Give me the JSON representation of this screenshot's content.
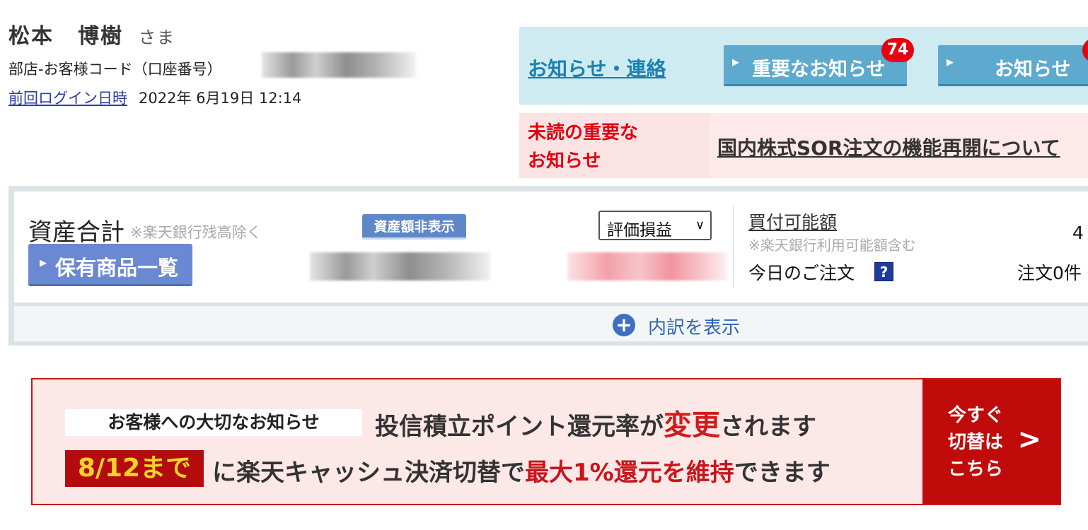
{
  "customer": {
    "family_name": "松本",
    "given_name": "博樹",
    "honorific": "さま",
    "code_label": "部店-お客様コード（口座番号）",
    "last_login_label": "前回ログイン日時",
    "last_login_value": "2022年 6月19日 12:14"
  },
  "notices": {
    "link_label": "お知らせ・連絡",
    "important_button": "重要なお知らせ",
    "important_badge": "74",
    "notices_button": "お知らせ",
    "unread_label_line1": "未読の重要な",
    "unread_label_line2": "お知らせ",
    "unread_link": "国内株式SOR注文の機能再開について"
  },
  "assets": {
    "title": "資産合計",
    "note": "※楽天銀行残高除く",
    "hide_button": "資産額非表示",
    "holdings_button": "保有商品一覧",
    "pl_select": "評価損益",
    "buying_power_label": "買付可能額",
    "buying_power_note": "※楽天銀行利用可能額含む",
    "buying_power_value": "4",
    "today_orders_label": "今日のご注文",
    "help_icon_glyph": "?",
    "orders_count": "注文0件",
    "breakdown_label": "内訳を表示"
  },
  "banner": {
    "tag": "お客様への大切なお知らせ",
    "line1_pre": "投信積立ポイント還元率が",
    "line1_red": "変更",
    "line1_post": "されます",
    "date_badge": "8/12まで",
    "line2_pre": "に楽天キャッシュ決済切替で",
    "line2_red": "最大1%還元を維持",
    "line2_post": "できます",
    "cta_line1": "今すぐ",
    "cta_line2": "切替は",
    "cta_line3": "こちら"
  },
  "colors": {
    "notice_bg": "#cdebf1",
    "notice_button": "#5ea9ce",
    "badge_red": "#e8000f",
    "unread_bg": "#fbe3e3",
    "asset_button": "#6b88d2",
    "banner_red": "#c00b0b",
    "banner_bg": "#fde8e8",
    "banner_highlight": "#fad22a"
  },
  "icons": {
    "button_arrow": "triangle-right-icon",
    "select_chevron": "chevron-down-icon",
    "help": "question-mark-icon",
    "breakdown": "plus-circle-icon",
    "cta_arrow": "chevron-right-icon"
  }
}
